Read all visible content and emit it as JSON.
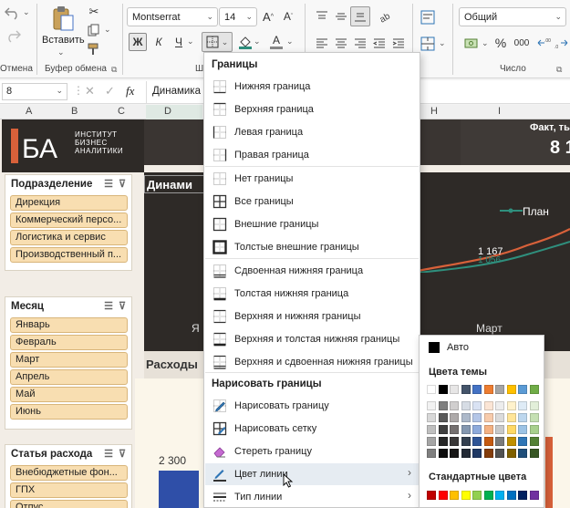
{
  "ribbon": {
    "undo_group_label": "Отмена",
    "paste_label": "Вставить",
    "clipboard_label": "Буфер обмена",
    "font_name": "Montserrat",
    "font_size": "14",
    "bold": "Ж",
    "italic": "К",
    "underline": "Ч",
    "font_group_label_fragment": "Ш",
    "number_format": "Общий",
    "number_group_label": "Число",
    "percent": "%",
    "thousands": "000"
  },
  "formula_bar": {
    "name_box": "8",
    "fx": "fx",
    "content": "Динамика"
  },
  "columns": [
    "A",
    "B",
    "C",
    "D",
    "H",
    "I"
  ],
  "sheet": {
    "logo_abbrev": "БА",
    "logo_text": [
      "ИНСТИТУТ",
      "БИЗНЕС",
      "АНАЛИТИКИ"
    ],
    "fact_title": "Факт, ты",
    "fact_value": "8 1",
    "dynamics_title": "Динами",
    "legend_plan": "План",
    "point_label_1": "1 167",
    "point_label_2": "1 056",
    "month_label": "Март",
    "month_label_left": "Я",
    "expenses_title": "Расходы",
    "bar_value": "2 300"
  },
  "slicers": [
    {
      "title": "Подразделение",
      "items": [
        "Дирекция",
        "Коммерческий персо...",
        "Логистика и сервис",
        "Производственный п..."
      ]
    },
    {
      "title": "Месяц",
      "items": [
        "Январь",
        "Февраль",
        "Март",
        "Апрель",
        "Май",
        "Июнь"
      ]
    },
    {
      "title": "Статья расхода",
      "items": [
        "Внебюджетные фон...",
        "ГПХ",
        "Отпус"
      ]
    }
  ],
  "borders_menu": {
    "header": "Границы",
    "items": [
      {
        "label": "Нижняя граница",
        "icon": "border-bottom-icon"
      },
      {
        "label": "Верхняя граница",
        "icon": "border-top-icon"
      },
      {
        "label": "Левая граница",
        "icon": "border-left-icon"
      },
      {
        "label": "Правая граница",
        "icon": "border-right-icon"
      },
      {
        "label": "Нет границы",
        "icon": "border-none-icon"
      },
      {
        "label": "Все границы",
        "icon": "border-all-icon"
      },
      {
        "label": "Внешние границы",
        "icon": "border-outside-icon"
      },
      {
        "label": "Толстые внешние границы",
        "icon": "border-thick-outside-icon"
      },
      {
        "label": "Сдвоенная нижняя граница",
        "icon": "border-double-bottom-icon"
      },
      {
        "label": "Толстая нижняя граница",
        "icon": "border-thick-bottom-icon"
      },
      {
        "label": "Верхняя и нижняя границы",
        "icon": "border-top-bottom-icon"
      },
      {
        "label": "Верхняя и толстая нижняя границы",
        "icon": "border-top-thick-bottom-icon"
      },
      {
        "label": "Верхняя и сдвоенная нижняя границы",
        "icon": "border-top-double-bottom-icon"
      }
    ],
    "draw_header": "Нарисовать границы",
    "draw_items": [
      {
        "label": "Нарисовать границу",
        "icon": "draw-border-icon"
      },
      {
        "label": "Нарисовать сетку",
        "icon": "draw-grid-icon"
      },
      {
        "label": "Стереть границу",
        "icon": "eraser-icon"
      },
      {
        "label": "Цвет линии",
        "icon": "line-color-icon"
      },
      {
        "label": "Тип линии",
        "icon": "line-style-icon"
      }
    ]
  },
  "color_menu": {
    "auto_label": "Авто",
    "theme_label": "Цвета темы",
    "standard_label": "Стандартные цвета",
    "theme_top": [
      "#ffffff",
      "#000000",
      "#e7e6e6",
      "#44546a",
      "#4472c4",
      "#ed7d31",
      "#a5a5a5",
      "#ffc000",
      "#5b9bd5",
      "#70ad47"
    ],
    "theme_columns": [
      [
        "#f2f2f2",
        "#d8d8d8",
        "#bfbfbf",
        "#a5a5a5",
        "#7f7f7f"
      ],
      [
        "#7f7f7f",
        "#595959",
        "#3f3f3f",
        "#262626",
        "#0c0c0c"
      ],
      [
        "#d0cece",
        "#aeaaaa",
        "#757070",
        "#3a3838",
        "#171616"
      ],
      [
        "#d6dce4",
        "#adb9ca",
        "#8497b0",
        "#333f4f",
        "#222a35"
      ],
      [
        "#d9e2f3",
        "#b4c6e7",
        "#8eaadb",
        "#2f5496",
        "#1f3864"
      ],
      [
        "#fbe5d5",
        "#f7cbac",
        "#f4b183",
        "#c55a11",
        "#833c0b"
      ],
      [
        "#ededed",
        "#dbdbdb",
        "#c9c9c9",
        "#7b7b7b",
        "#525252"
      ],
      [
        "#fff2cc",
        "#ffe599",
        "#ffd966",
        "#bf8f00",
        "#7f6000"
      ],
      [
        "#deebf6",
        "#bdd7ee",
        "#9cc3e5",
        "#2e75b5",
        "#1f4e79"
      ],
      [
        "#e2efd9",
        "#c5e0b3",
        "#a8d08d",
        "#538135",
        "#375623"
      ]
    ],
    "standard": [
      "#c00000",
      "#ff0000",
      "#ffc000",
      "#ffff00",
      "#92d050",
      "#00b050",
      "#00b0f0",
      "#0070c0",
      "#002060",
      "#7030a0"
    ],
    "auto_color": "#000000"
  },
  "colors": {
    "accent_orange": "#d8613a",
    "accent_teal": "#2f8f7d",
    "dark_panel": "#2e2a27",
    "slicer_item": "#f8deb1"
  }
}
